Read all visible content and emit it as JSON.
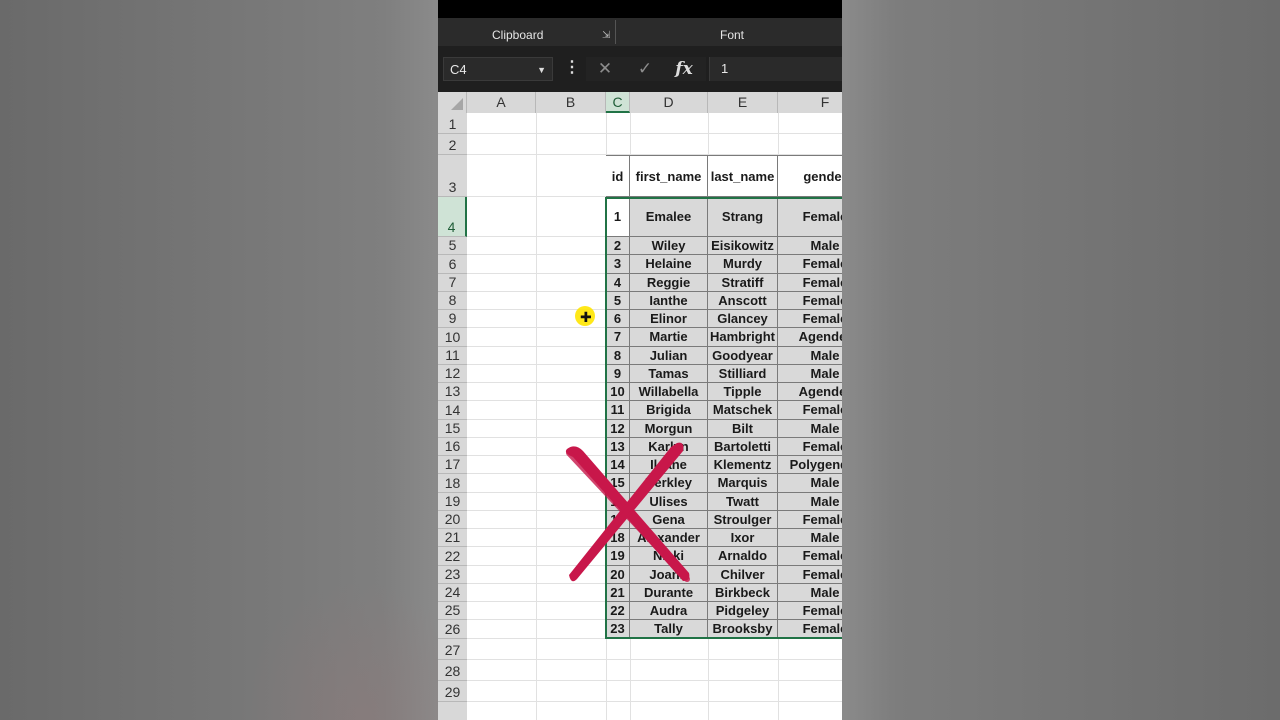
{
  "ribbon": {
    "group1": "Clipboard",
    "group2": "Font"
  },
  "formula_bar": {
    "name_box": "C4",
    "formula_value": "1",
    "cancel_icon": "close-icon",
    "enter_icon": "check-icon",
    "fx_label": "fx"
  },
  "columns": [
    "A",
    "B",
    "C",
    "D",
    "E",
    "F"
  ],
  "rows": [
    "1",
    "2",
    "3",
    "4",
    "5",
    "6",
    "7",
    "8",
    "9",
    "10",
    "11",
    "12",
    "13",
    "14",
    "15",
    "16",
    "17",
    "18",
    "19",
    "20",
    "21",
    "22",
    "23",
    "24",
    "25",
    "26",
    "27",
    "28",
    "29"
  ],
  "table": {
    "headers": [
      "id",
      "first_name",
      "last_name",
      "gender"
    ],
    "rows": [
      [
        "1",
        "Emalee",
        "Strang",
        "Female"
      ],
      [
        "2",
        "Wiley",
        "Eisikowitz",
        "Male"
      ],
      [
        "3",
        "Helaine",
        "Murdy",
        "Female"
      ],
      [
        "4",
        "Reggie",
        "Stratiff",
        "Female"
      ],
      [
        "5",
        "Ianthe",
        "Anscott",
        "Female"
      ],
      [
        "6",
        "Elinor",
        "Glancey",
        "Female"
      ],
      [
        "7",
        "Martie",
        "Hambright",
        "Agender"
      ],
      [
        "8",
        "Julian",
        "Goodyear",
        "Male"
      ],
      [
        "9",
        "Tamas",
        "Stilliard",
        "Male"
      ],
      [
        "10",
        "Willabella",
        "Tipple",
        "Agender"
      ],
      [
        "11",
        "Brigida",
        "Matschek",
        "Female"
      ],
      [
        "12",
        "Morgun",
        "Bilt",
        "Male"
      ],
      [
        "13",
        "Karlyn",
        "Bartoletti",
        "Female"
      ],
      [
        "14",
        "Ileane",
        "Klementz",
        "Polygender"
      ],
      [
        "15",
        "Berkley",
        "Marquis",
        "Male"
      ],
      [
        "16",
        "Ulises",
        "Twatt",
        "Male"
      ],
      [
        "17",
        "Gena",
        "Stroulger",
        "Female"
      ],
      [
        "18",
        "Alexander",
        "Ixor",
        "Male"
      ],
      [
        "19",
        "Nicki",
        "Arnaldo",
        "Female"
      ],
      [
        "20",
        "Joann",
        "Chilver",
        "Female"
      ],
      [
        "21",
        "Durante",
        "Birkbeck",
        "Male"
      ],
      [
        "22",
        "Audra",
        "Pidgeley",
        "Female"
      ],
      [
        "23",
        "Tally",
        "Brooksby",
        "Female"
      ]
    ]
  },
  "overlay": {
    "mark_icon": "red-x-mark-icon",
    "mark_color": "#c8174a",
    "cursor_color": "#ffe600"
  },
  "colors": {
    "accent": "#217346",
    "ribbon_bg": "#2b2b2b"
  }
}
